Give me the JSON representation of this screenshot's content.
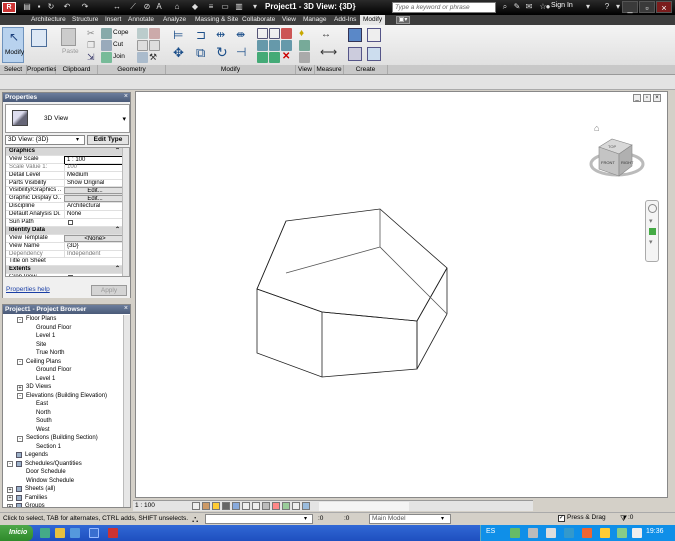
{
  "app": {
    "title": "Project1 - 3D View: {3D}",
    "search_placeholder": "Type a keyword or phrase",
    "signin": "Sign In"
  },
  "ribbon": {
    "tabs": [
      "Architecture",
      "Structure",
      "Insert",
      "Annotate",
      "Analyze",
      "Massing & Site",
      "Collaborate",
      "View",
      "Manage",
      "Add-Ins",
      "Modify"
    ],
    "active_tab": "Modify",
    "modify_label": "Modify",
    "panels": {
      "select": "Select",
      "properties": "Properties",
      "clipboard": "Clipboard",
      "geometry": "Geometry",
      "modify": "Modify",
      "view": "View",
      "measure": "Measure",
      "create": "Create"
    },
    "clipboard": {
      "paste": "Paste"
    },
    "geometry": {
      "cope": "Cope",
      "cut": "Cut",
      "join": "Join"
    }
  },
  "properties": {
    "title": "Properties",
    "type_name": "3D View",
    "view_selector": "3D View: {3D}",
    "edit_type": "Edit Type",
    "rows": [
      {
        "kind": "group",
        "name": "Graphics"
      },
      {
        "kind": "row",
        "name": "View Scale",
        "value": "1 : 100",
        "style": "hl"
      },
      {
        "kind": "row",
        "name": "Scale Value    1:",
        "value": "100",
        "style": "dim"
      },
      {
        "kind": "row",
        "name": "Detail Level",
        "value": "Medium"
      },
      {
        "kind": "row",
        "name": "Parts Visibility",
        "value": "Show Original"
      },
      {
        "kind": "row",
        "name": "Visibility/Graphics ...",
        "value": "Edit...",
        "style": "btn"
      },
      {
        "kind": "row",
        "name": "Graphic Display O...",
        "value": "Edit...",
        "style": "btn"
      },
      {
        "kind": "row",
        "name": "Discipline",
        "value": "Architectural"
      },
      {
        "kind": "row",
        "name": "Default Analysis Di...",
        "value": "None"
      },
      {
        "kind": "row",
        "name": "Sun Path",
        "value": ""
      },
      {
        "kind": "group",
        "name": "Identity Data"
      },
      {
        "kind": "row",
        "name": "View Template",
        "value": "<None>",
        "style": "btn"
      },
      {
        "kind": "row",
        "name": "View Name",
        "value": "{3D}"
      },
      {
        "kind": "row",
        "name": "Dependency",
        "value": "Independent",
        "style": "dim"
      },
      {
        "kind": "row",
        "name": "Title on Sheet",
        "value": ""
      },
      {
        "kind": "group",
        "name": "Extents"
      },
      {
        "kind": "row",
        "name": "Crop View",
        "value": ""
      }
    ],
    "help_link": "Properties help",
    "apply": "Apply"
  },
  "browser": {
    "title": "Project1 - Project Browser",
    "nodes": [
      {
        "level": 1,
        "label": "Floor Plans",
        "exp": "-"
      },
      {
        "level": 2,
        "label": "Ground Floor"
      },
      {
        "level": 2,
        "label": "Level 1"
      },
      {
        "level": 2,
        "label": "Site"
      },
      {
        "level": 2,
        "label": "True North"
      },
      {
        "level": 1,
        "label": "Ceiling Plans",
        "exp": "-"
      },
      {
        "level": 2,
        "label": "Ground Floor"
      },
      {
        "level": 2,
        "label": "Level 1"
      },
      {
        "level": 1,
        "label": "3D Views",
        "exp": "+"
      },
      {
        "level": 1,
        "label": "Elevations (Building Elevation)",
        "exp": "-"
      },
      {
        "level": 2,
        "label": "East"
      },
      {
        "level": 2,
        "label": "North"
      },
      {
        "level": 2,
        "label": "South"
      },
      {
        "level": 2,
        "label": "West"
      },
      {
        "level": 1,
        "label": "Sections (Building Section)",
        "exp": "-"
      },
      {
        "level": 2,
        "label": "Section 1"
      },
      {
        "level": 0,
        "label": "Legends",
        "icon": true
      },
      {
        "level": 0,
        "label": "Schedules/Quantities",
        "exp": "-",
        "icon": true
      },
      {
        "level": 1,
        "label": "Door Schedule"
      },
      {
        "level": 1,
        "label": "Window Schedule"
      },
      {
        "level": 0,
        "label": "Sheets (all)",
        "exp": "+",
        "icon": true
      },
      {
        "level": 0,
        "label": "Families",
        "exp": "+",
        "icon": true
      },
      {
        "level": 0,
        "label": "Groups",
        "exp": "+",
        "icon": true
      }
    ]
  },
  "viewcube": {
    "front": "FRONT",
    "right": "RIGHT",
    "top": "TOP"
  },
  "viewbar": {
    "scale": "1 : 100"
  },
  "statusbar": {
    "text": "Click to select, TAB for alternates, CTRL adds, SHIFT unselects.",
    "sel_count": ":0",
    "workset_count": ":0",
    "model": "Main Model",
    "press_drag": "Press & Drag",
    "filter_count": ":0"
  },
  "taskbar": {
    "start": "Inicio",
    "lang": "ES",
    "clock": "19:36"
  },
  "colors": {
    "ribbon_bg": "#e6e6e6",
    "title_bg": "#1a1a1a",
    "taskbar": "#2458cc",
    "palette_header": "#5a6b8a"
  }
}
